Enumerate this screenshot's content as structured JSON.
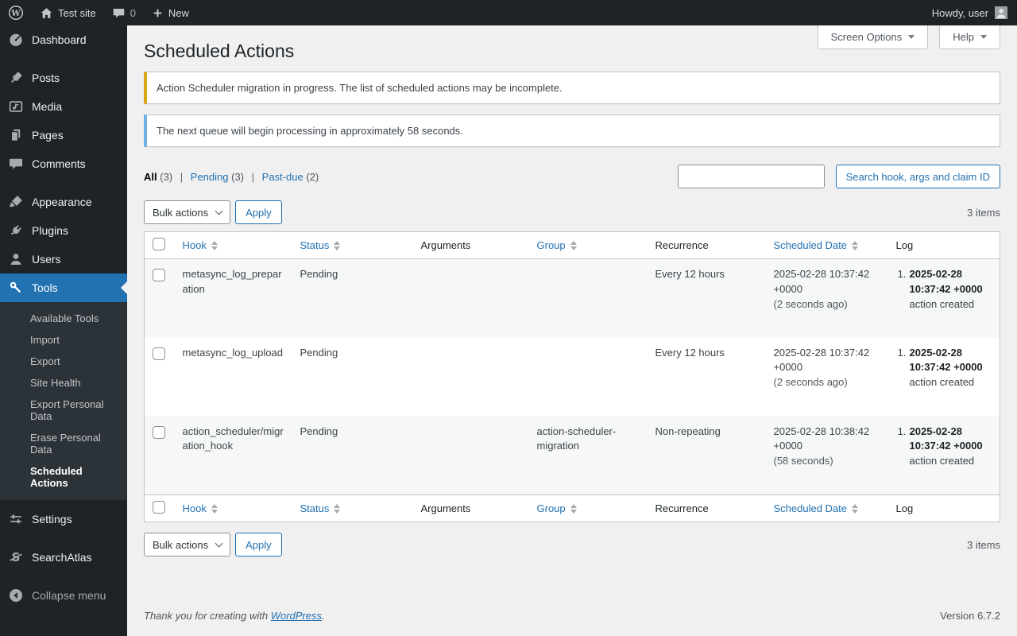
{
  "admin_bar": {
    "site_name": "Test site",
    "comments_count": "0",
    "new_label": "New",
    "howdy_text": "Howdy, user"
  },
  "screen_meta": {
    "screen_options_label": "Screen Options",
    "help_label": "Help"
  },
  "page": {
    "title": "Scheduled Actions"
  },
  "notices": [
    {
      "text": "Action Scheduler migration in progress. The list of scheduled actions may be incomplete.",
      "accent_color": "#dba617"
    },
    {
      "text": "The next queue will begin processing in approximately 58 seconds.",
      "accent_color": "#72aee6"
    }
  ],
  "filters": [
    {
      "label": "All",
      "count": "(3)",
      "current": true
    },
    {
      "label": "Pending",
      "count": "(3)",
      "current": false
    },
    {
      "label": "Past-due",
      "count": "(2)",
      "current": false
    }
  ],
  "search": {
    "value": "",
    "button_label": "Search hook, args and claim ID"
  },
  "tablenav": {
    "bulk_actions_label": "Bulk actions",
    "apply_label": "Apply",
    "items_count": "3 items"
  },
  "table": {
    "columns": [
      {
        "label": "Hook",
        "sortable": true
      },
      {
        "label": "Status",
        "sortable": true
      },
      {
        "label": "Arguments",
        "sortable": false
      },
      {
        "label": "Group",
        "sortable": true
      },
      {
        "label": "Recurrence",
        "sortable": false
      },
      {
        "label": "Scheduled Date",
        "sortable": true
      },
      {
        "label": "Log",
        "sortable": false
      }
    ],
    "rows": [
      {
        "hook": "metasync_log_preparation",
        "status": "Pending",
        "arguments": "",
        "group": "",
        "recurrence": "Every 12 hours",
        "scheduled_date": "2025-02-28 10:37:42 +0000",
        "scheduled_relative": "(2 seconds ago)",
        "log_index": "1.",
        "log_date": "2025-02-28 10:37:42 +0000",
        "log_text": "action created"
      },
      {
        "hook": "metasync_log_upload",
        "status": "Pending",
        "arguments": "",
        "group": "",
        "recurrence": "Every 12 hours",
        "scheduled_date": "2025-02-28 10:37:42 +0000",
        "scheduled_relative": "(2 seconds ago)",
        "log_index": "1.",
        "log_date": "2025-02-28 10:37:42 +0000",
        "log_text": "action created"
      },
      {
        "hook": "action_scheduler/migration_hook",
        "status": "Pending",
        "arguments": "",
        "group": "action-scheduler-migration",
        "recurrence": "Non-repeating",
        "scheduled_date": "2025-02-28 10:38:42 +0000",
        "scheduled_relative": "(58 seconds)",
        "log_index": "1.",
        "log_date": "2025-02-28 10:37:42 +0000",
        "log_text": "action created"
      }
    ]
  },
  "sidebar": {
    "items": [
      {
        "label": "Dashboard",
        "icon": "dashboard-icon"
      },
      {
        "label": "Posts",
        "icon": "pushpin-icon"
      },
      {
        "label": "Media",
        "icon": "media-icon"
      },
      {
        "label": "Pages",
        "icon": "pages-icon"
      },
      {
        "label": "Comments",
        "icon": "comment-icon"
      },
      {
        "label": "Appearance",
        "icon": "brush-icon"
      },
      {
        "label": "Plugins",
        "icon": "plug-icon"
      },
      {
        "label": "Users",
        "icon": "user-icon"
      },
      {
        "label": "Tools",
        "icon": "wrench-icon",
        "active": true
      },
      {
        "label": "Settings",
        "icon": "sliders-icon"
      },
      {
        "label": "SearchAtlas",
        "icon": "searchatlas-icon"
      }
    ],
    "tools_submenu": [
      {
        "label": "Available Tools",
        "current": false
      },
      {
        "label": "Import",
        "current": false
      },
      {
        "label": "Export",
        "current": false
      },
      {
        "label": "Site Health",
        "current": false
      },
      {
        "label": "Export Personal Data",
        "current": false
      },
      {
        "label": "Erase Personal Data",
        "current": false
      },
      {
        "label": "Scheduled Actions",
        "current": true
      }
    ],
    "collapse_label": "Collapse menu"
  },
  "footer": {
    "thanks_prefix": "Thank you for creating with",
    "wordpress_link": "WordPress",
    "suffix": ".",
    "version": "Version 6.7.2"
  }
}
